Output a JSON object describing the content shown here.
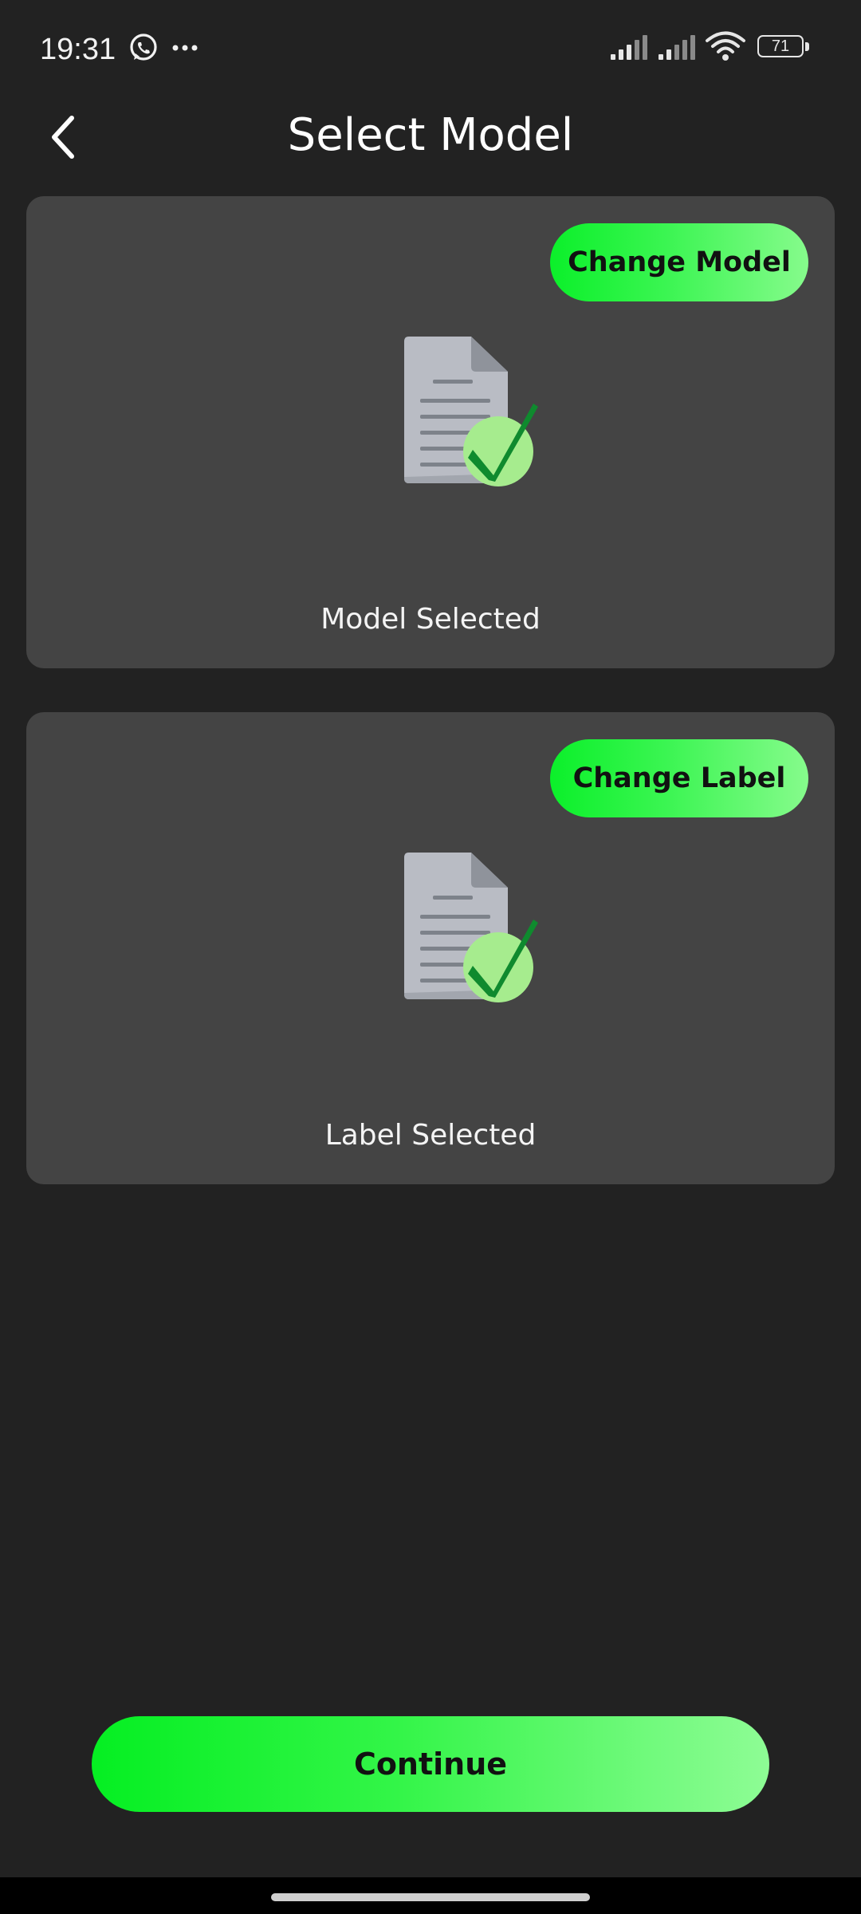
{
  "status_bar": {
    "time": "19:31",
    "battery_level": "71",
    "icons": [
      "whatsapp-icon",
      "more-dots-icon",
      "signal-icon",
      "signal-icon",
      "wifi-icon",
      "battery-icon"
    ]
  },
  "app_bar": {
    "title": "Select Model",
    "back_icon": "chevron-left-icon"
  },
  "cards": {
    "model": {
      "button_label": "Change Model",
      "caption": "Model Selected",
      "icon": "document-check-icon"
    },
    "label": {
      "button_label": "Change Label",
      "caption": "Label Selected",
      "icon": "document-check-icon"
    }
  },
  "continue_label": "Continue",
  "colors": {
    "background": "#222222",
    "card": "#444444",
    "accent_start": "#05ef22",
    "accent_end": "#8efc95",
    "check_dark": "#0f8a2e",
    "check_circle": "#a6ec8e"
  }
}
